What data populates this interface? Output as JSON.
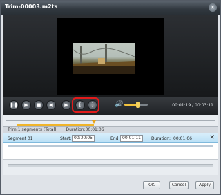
{
  "window": {
    "title": "Trim-00003.m2ts"
  },
  "controls": {
    "timecode": "00:01:19 / 00:03:11",
    "volume_fraction": 0.55
  },
  "timeline": {
    "start_fraction": 0.05,
    "end_fraction": 0.42,
    "playhead_fraction": 0.42
  },
  "segments": {
    "summary": "Trim:1 segments (Total)",
    "duration_total": "Duration:00:01:06",
    "rows": [
      {
        "name": "Segment 01",
        "start_label": "Start:",
        "start": "00:00:05",
        "end_label": "End:",
        "end": "00:01:11",
        "duration_label": "Duration:",
        "duration": "00:01:06"
      }
    ]
  },
  "buttons": {
    "ok": "OK",
    "cancel": "Cancel",
    "apply": "Apply"
  },
  "colors": {
    "accent": "#f0b42a",
    "highlight": "#e21b1b",
    "selected_row": "#b9dff5"
  }
}
